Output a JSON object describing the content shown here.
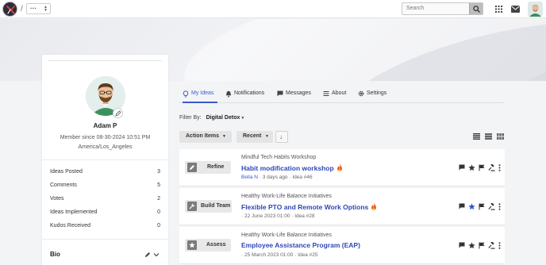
{
  "header": {
    "separator": "/",
    "crumb": "···",
    "search_placeholder": "Search"
  },
  "profile": {
    "name": "Adam P",
    "member_since": "Member since 08-30-2024 10:51 PM",
    "timezone": "America/Los_Angeles",
    "stats": [
      {
        "label": "Ideas Posted",
        "value": "3"
      },
      {
        "label": "Comments",
        "value": "5"
      },
      {
        "label": "Votes",
        "value": "2"
      },
      {
        "label": "Ideas Implemented",
        "value": "0"
      },
      {
        "label": "Kudos Received",
        "value": "0"
      }
    ],
    "bio_label": "Bio"
  },
  "tabs": [
    {
      "label": "My Ideas",
      "icon": "lightbulb-icon",
      "active": true
    },
    {
      "label": "Notifications",
      "icon": "bell-icon",
      "active": false
    },
    {
      "label": "Messages",
      "icon": "message-icon",
      "active": false
    },
    {
      "label": "About",
      "icon": "list-icon",
      "active": false
    },
    {
      "label": "Settings",
      "icon": "gear-icon",
      "active": false
    }
  ],
  "filter": {
    "label": "Filter By:",
    "value": "Digital Detox"
  },
  "toolbar": {
    "action_items": "Action Items",
    "recent": "Recent"
  },
  "ideas": [
    {
      "stage": "Refine",
      "stage_icon": "pencil-icon",
      "category": "Mindful Tech Habits Workshop",
      "title": "Habit modification workshop",
      "author": "Bella N",
      "meta": " · 3 days ago · Idea #46",
      "starred": false
    },
    {
      "stage": "Build Team",
      "stage_icon": "wrench-icon",
      "category": "Healthy Work-Life Balance Initiatives",
      "title": "Flexible PTO and Remote Work Options",
      "author": "",
      "meta": "· 22 June 2023 01:00 · Idea #28",
      "starred": true
    },
    {
      "stage": "Assess",
      "stage_icon": "star-icon",
      "category": "Healthy Work-Life Balance Initiatives",
      "title": "Employee Assistance Program (EAP)",
      "author": "",
      "meta": "· 25 March 2023 01:00 · Idea #25",
      "starred": false
    }
  ],
  "colors": {
    "accent": "#3a5bcd",
    "title_link": "#2d47b8",
    "fire": "#e8571b"
  }
}
